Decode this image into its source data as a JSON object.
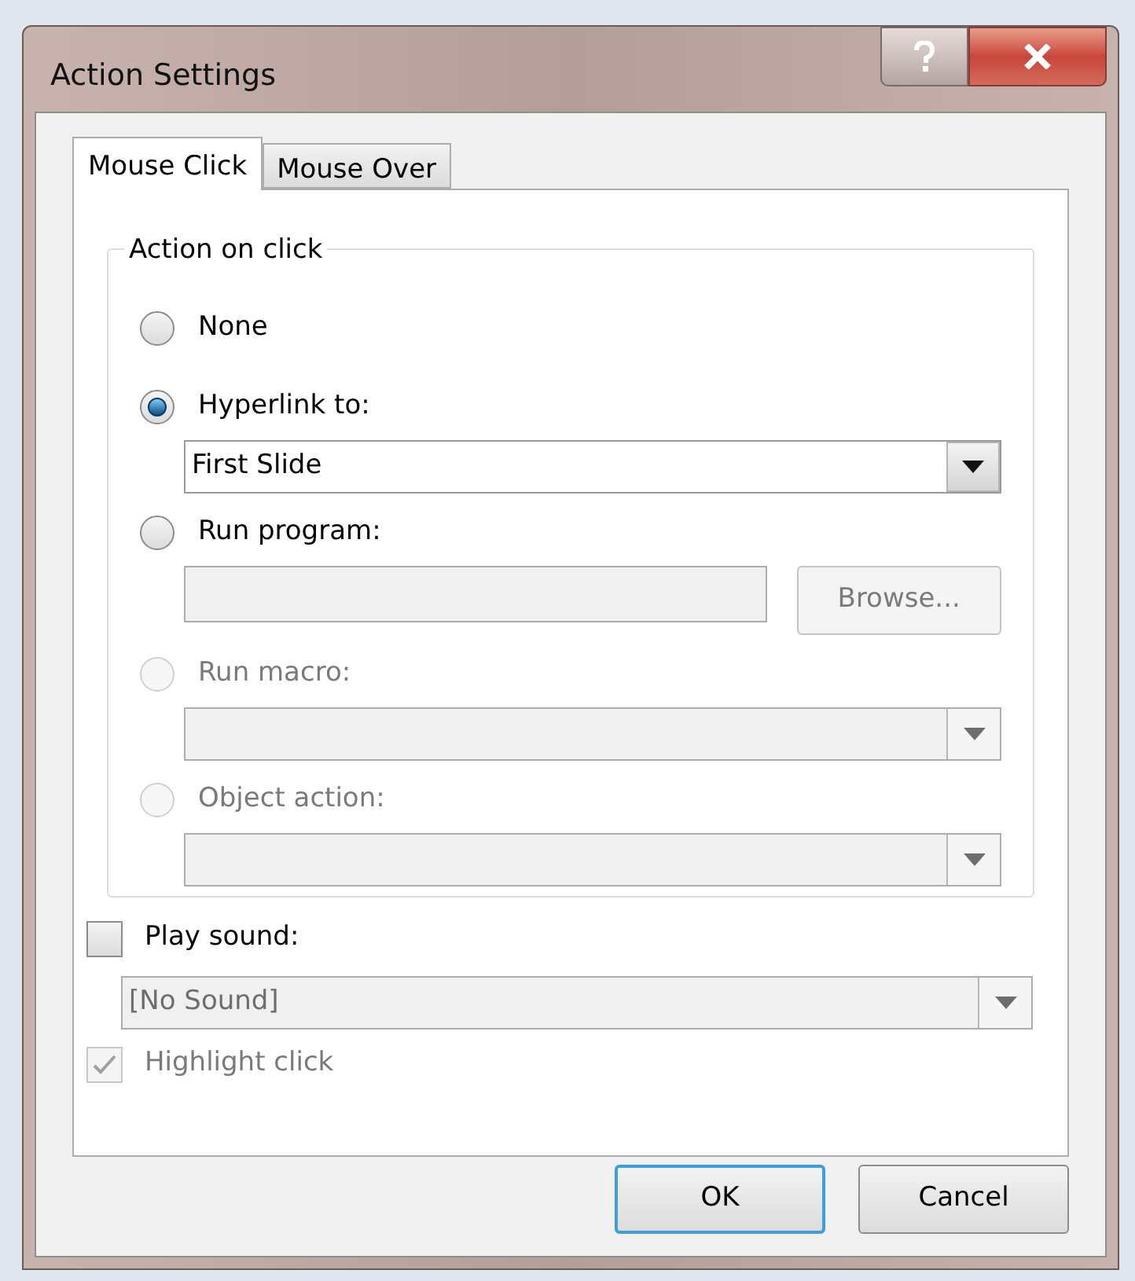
{
  "window": {
    "title": "Action Settings"
  },
  "tabs": [
    {
      "label": "Mouse Click",
      "selected": true
    },
    {
      "label": "Mouse Over",
      "selected": false
    }
  ],
  "group": {
    "title": "Action on click",
    "options": [
      {
        "label": "None",
        "selected": false,
        "disabled": false
      },
      {
        "label": "Hyperlink to:",
        "selected": true,
        "disabled": false,
        "control": {
          "kind": "dropdown",
          "value": "First Slide",
          "disabled": false
        }
      },
      {
        "label": "Run program:",
        "selected": false,
        "disabled": false,
        "control": {
          "kind": "field_button",
          "button": "Browse...",
          "disabled": true
        }
      },
      {
        "label": "Run macro:",
        "selected": false,
        "disabled": true,
        "control": {
          "kind": "dropdown",
          "disabled": true
        }
      },
      {
        "label": "Object action:",
        "selected": false,
        "disabled": true,
        "control": {
          "kind": "dropdown",
          "disabled": true
        }
      }
    ]
  },
  "play_sound": {
    "label": "Play sound:",
    "checked": false,
    "disabled": false
  },
  "sound": {
    "value": "[No Sound]",
    "disabled": true
  },
  "highlight_click": {
    "label": "Highlight click",
    "checked": true,
    "disabled": true
  },
  "buttons": [
    {
      "label": "OK",
      "default": true
    },
    {
      "label": "Cancel",
      "default": false
    }
  ]
}
